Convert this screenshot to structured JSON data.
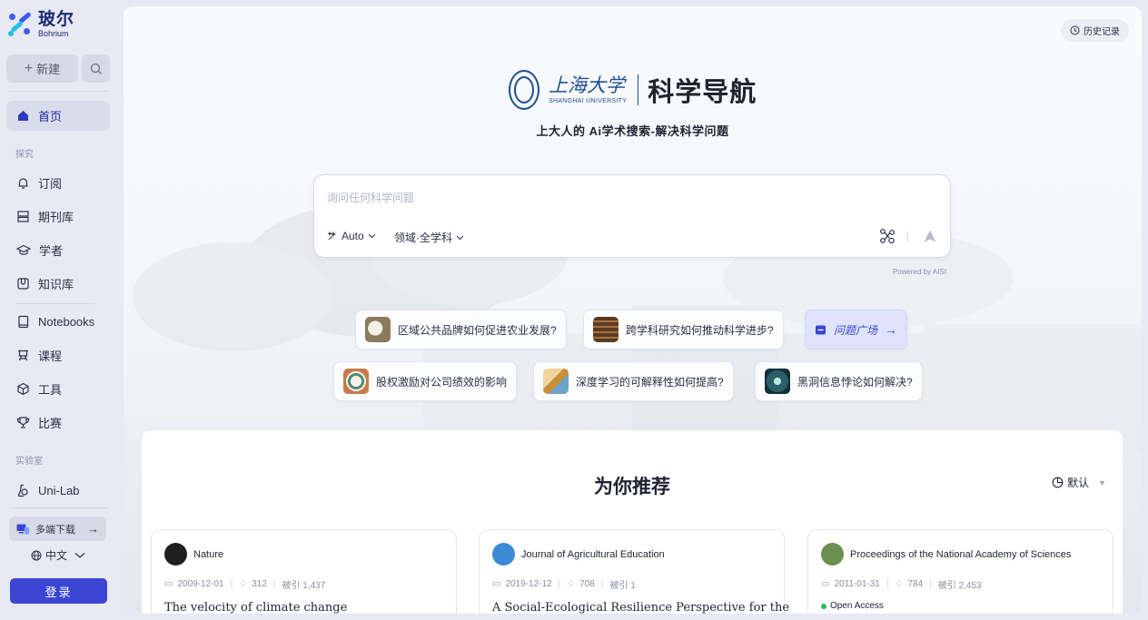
{
  "sidebar": {
    "logo_cn": "玻尔",
    "logo_en": "Bohrium",
    "new_label": "新建",
    "nav": [
      {
        "label": "首页",
        "icon": "home-icon"
      },
      {
        "label": "订阅",
        "icon": "bell-icon"
      },
      {
        "label": "期刊库",
        "icon": "journal-icon"
      },
      {
        "label": "学者",
        "icon": "scholar-cap-icon"
      },
      {
        "label": "知识库",
        "icon": "knowledge-icon"
      },
      {
        "label": "Notebooks",
        "icon": "notebook-icon"
      },
      {
        "label": "课程",
        "icon": "course-icon"
      },
      {
        "label": "工具",
        "icon": "cube-icon"
      },
      {
        "label": "比赛",
        "icon": "trophy-icon"
      },
      {
        "label": "Uni-Lab",
        "icon": "lab-icon"
      }
    ],
    "section_explore": "探究",
    "section_lab": "实验室",
    "download_label": "多端下载",
    "language": "中文",
    "login_label": "登录"
  },
  "header": {
    "history_label": "历史记录",
    "univ_cn": "上海大学",
    "univ_en": "SHANGHAI UNIVERSITY",
    "brand_title": "科学导航",
    "tagline": "上大人的 Ai学术搜索-解决科学问题"
  },
  "search": {
    "placeholder": "询问任何科学问题",
    "mode": "Auto",
    "field": "领域·全学科",
    "powered_by": "Powered by AISI"
  },
  "suggestions": [
    {
      "label": "区域公共品牌如何促进农业发展?",
      "color": "#8b7a5c"
    },
    {
      "label": "跨学科研究如何推动科学进步?",
      "color": "#5a3b22"
    },
    {
      "label": "股权激励对公司绩效的影响",
      "color": "#4f8a7a"
    },
    {
      "label": "深度学习的可解释性如何提高?",
      "color": "#c98f3a"
    },
    {
      "label": "黑洞信息悖论如何解决?",
      "color": "#2c5e6a"
    }
  ],
  "plaza_label": "问题广场",
  "recommend": {
    "title": "为你推荐",
    "sort_label": "默认",
    "cards": [
      {
        "source": "Nature",
        "date": "2009-12-01",
        "likes": "312",
        "cited": "被引 1,437",
        "open_access": "",
        "title": "The velocity of climate change",
        "avatar_color": "#1f1f1f"
      },
      {
        "source": "Journal of Agricultural Education",
        "date": "2019-12-12",
        "likes": "708",
        "cited": "被引 1",
        "open_access": "",
        "title": "A Social-Ecological Resilience Perspective for the",
        "avatar_color": "#3c8ad6"
      },
      {
        "source": "Proceedings of the National Academy of Sciences",
        "date": "2011-01-31",
        "likes": "784",
        "cited": "被引 2,453",
        "open_access": "Open Access",
        "title": "",
        "avatar_color": "#6b8f4e"
      }
    ]
  },
  "colors": {
    "accent": "#3b45d4",
    "oa_green": "#1dbd5c",
    "univ_blue": "#1e4f8f"
  }
}
